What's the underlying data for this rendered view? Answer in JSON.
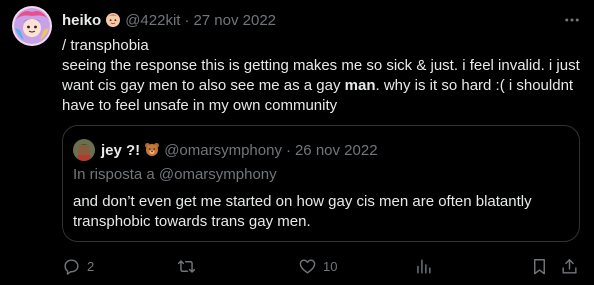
{
  "tweet": {
    "display_name": "heiko",
    "handle": "@422kit",
    "separator": "·",
    "date": "27 nov 2022",
    "line1": "/ transphobia",
    "body_part1": "seeing the response this is getting makes me so sick & just. i feel invalid. i just want cis gay men to also see me as a gay ",
    "body_bold": "man",
    "body_part2": ". why is it so hard :( i shouldnt have to feel unsafe in my own community"
  },
  "quote": {
    "display_name": "jey ?!",
    "handle": "@omarsymphony",
    "separator": "·",
    "date": "26 nov 2022",
    "reply_to": "In risposta a @omarsymphony",
    "text": "and don’t even get me started on how gay cis men are often blatantly transphobic towards trans gay men."
  },
  "actions": {
    "reply_count": "2",
    "retweet_count": "",
    "like_count": "10",
    "views_count": ""
  },
  "colors": {
    "background": "#000000",
    "text": "#e7e9ea",
    "muted": "#71767b",
    "border": "#2f3336"
  },
  "icons": [
    "avatar-art",
    "face-emoji",
    "more-icon",
    "bear-emoji",
    "reply-icon",
    "retweet-icon",
    "like-icon",
    "views-icon",
    "bookmark-icon",
    "share-icon"
  ]
}
